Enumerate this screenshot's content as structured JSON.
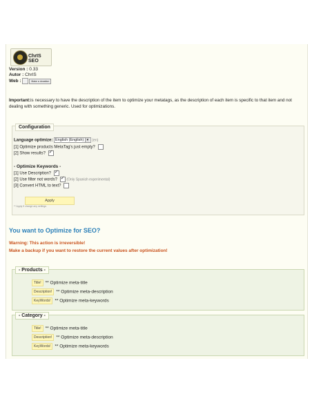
{
  "logo": {
    "text": "ChrIS SEO"
  },
  "meta": {
    "version_label": "Version :",
    "version_value": "0.33",
    "author_label": "Autor :",
    "author_value": "ChrIS",
    "web_label": "Web :",
    "donate_label": "Make a donation"
  },
  "important": {
    "bold": "Important:",
    "text": "is necessary to have the description of the item to optimize your metatags, as the description of each item is specific to that item and not dealing with something generic. Used for optimizations."
  },
  "configuration": {
    "legend": "Configuration",
    "language_label": "Language optimize:",
    "language_value": "English (English)",
    "language_hint": "(en)",
    "opt1_label": "[1] Optimize products MetaTag's just empty?",
    "opt1_checked": false,
    "opt2_label": "[2] Show results?",
    "opt2_checked": true,
    "keywords_header": "- Optimize Keywords -",
    "kw1_label": "[1] Use Description?",
    "kw1_checked": true,
    "kw2_label": "[2] Use filter not words?",
    "kw2_checked": true,
    "kw2_hint": "(Only Spanish experimental)",
    "kw3_label": "[3] Convert HTML to text?",
    "kw3_checked": false,
    "apply_label": "Apply",
    "apply_note": "** Apply if change any settings"
  },
  "seo": {
    "title": "You want to Optimize for SEO?",
    "warning": "Warning: This action is irreversible!",
    "backup": "Make a backup if you want to restore the current values after optimization!"
  },
  "products": {
    "legend": "- Products -",
    "items": [
      {
        "tag": "Title!",
        "label": "** Optimize meta-title"
      },
      {
        "tag": "Description!",
        "label": "** Optimize meta-description"
      },
      {
        "tag": "KeyWords!",
        "label": "** Optimize meta-keywords"
      }
    ]
  },
  "category": {
    "legend": "- Category -",
    "items": [
      {
        "tag": "Title!",
        "label": "** Optimize meta-title"
      },
      {
        "tag": "Description!",
        "label": "** Optimize meta-description"
      },
      {
        "tag": "KeyWords!",
        "label": "** Optimize meta-keywords"
      }
    ]
  }
}
